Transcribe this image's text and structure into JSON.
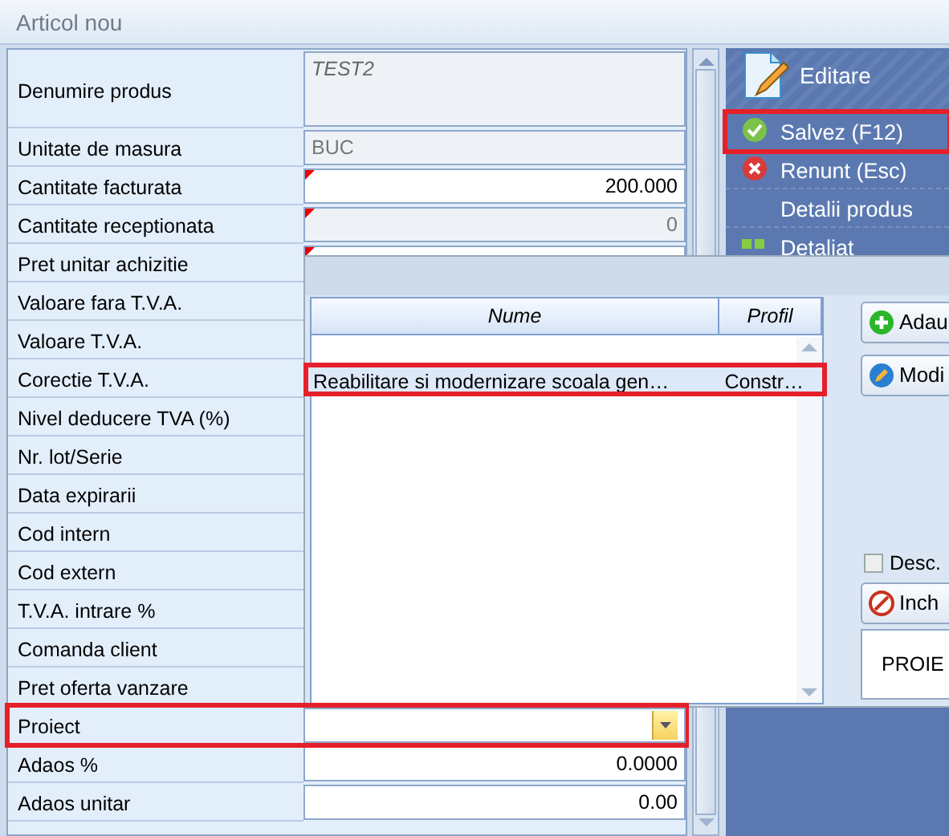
{
  "window": {
    "title": "Articol nou"
  },
  "fields": [
    {
      "label": "Denumire produs",
      "kind": "memo",
      "value": "TEST2",
      "readonly": true,
      "required": false,
      "highlighted": false
    },
    {
      "label": "Unitate de masura",
      "kind": "text",
      "value": "BUC",
      "readonly": true,
      "required": false,
      "highlighted": false
    },
    {
      "label": "Cantitate facturata",
      "kind": "number",
      "value": "200.000",
      "readonly": false,
      "required": true,
      "highlighted": false
    },
    {
      "label": "Cantitate receptionata",
      "kind": "number",
      "value": "0",
      "readonly": true,
      "required": true,
      "highlighted": false
    },
    {
      "label": "Pret unitar achizitie",
      "kind": "number",
      "readonly": false,
      "required": true,
      "highlighted": false
    },
    {
      "label": "Valoare fara T.V.A.",
      "kind": "covered",
      "highlighted": false
    },
    {
      "label": "Valoare T.V.A.",
      "kind": "covered",
      "highlighted": false
    },
    {
      "label": "Corectie T.V.A.",
      "kind": "covered",
      "highlighted": false
    },
    {
      "label": "Nivel deducere TVA (%)",
      "kind": "covered",
      "highlighted": false
    },
    {
      "label": "Nr. lot/Serie",
      "kind": "covered",
      "highlighted": false
    },
    {
      "label": "Data expirarii",
      "kind": "covered",
      "highlighted": false
    },
    {
      "label": "Cod intern",
      "kind": "covered",
      "highlighted": false
    },
    {
      "label": "Cod extern",
      "kind": "covered",
      "highlighted": false
    },
    {
      "label": "T.V.A. intrare %",
      "kind": "covered",
      "highlighted": false
    },
    {
      "label": "Comanda client",
      "kind": "covered",
      "highlighted": false
    },
    {
      "label": "Pret oferta vanzare",
      "kind": "covered",
      "highlighted": false
    },
    {
      "label": "Proiect",
      "kind": "combo",
      "readonly": false,
      "required": false,
      "highlighted": true
    },
    {
      "label": "Adaos %",
      "kind": "number",
      "value": "0.0000",
      "readonly": false,
      "required": false,
      "highlighted": false
    },
    {
      "label": "Adaos unitar",
      "kind": "number",
      "value": "0.00",
      "readonly": false,
      "required": false,
      "highlighted": false
    }
  ],
  "panel": {
    "title": "Editare",
    "items": [
      {
        "label": "Salvez (F12)",
        "kind": "save",
        "highlighted": true
      },
      {
        "label": "Renunt (Esc)",
        "kind": "cancel",
        "highlighted": false
      },
      {
        "label": "Detalii produs",
        "kind": "plain",
        "highlighted": false
      },
      {
        "label": "Detaliat",
        "kind": "grid",
        "highlighted": false
      }
    ]
  },
  "picker": {
    "columns": [
      "Nume",
      "Profil"
    ],
    "rows": [
      {
        "cells": [
          "Reabilitare si modernizare scoala gen…",
          "Constr…"
        ],
        "selected": true,
        "highlighted": true
      }
    ],
    "buttons": [
      {
        "label": "Adau",
        "kind": "add"
      },
      {
        "label": "Modi",
        "kind": "edit"
      }
    ],
    "checkbox": {
      "label": "Desc.",
      "checked": false
    },
    "close_button": {
      "label": "Inch"
    },
    "info": "PROIE"
  }
}
